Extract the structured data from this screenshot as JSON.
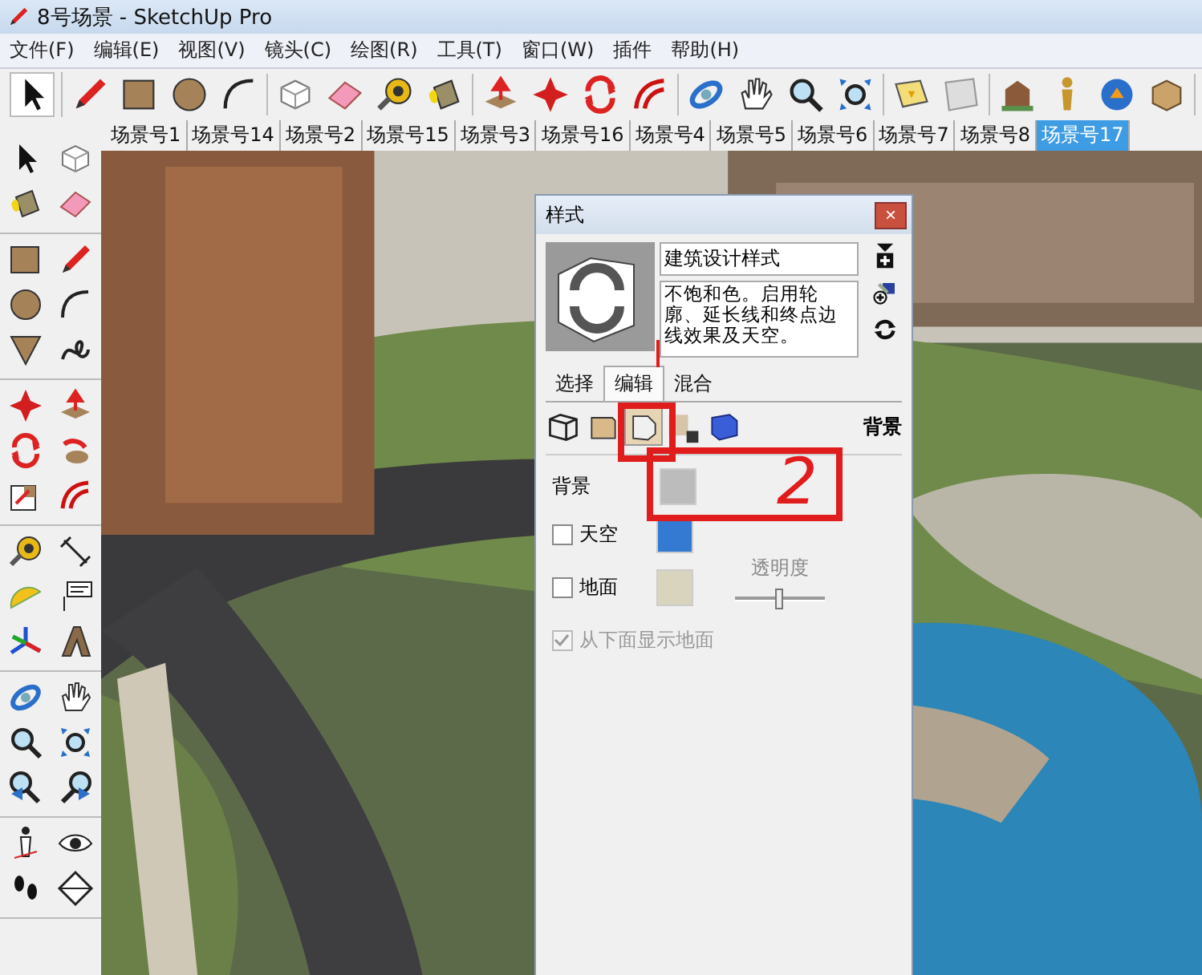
{
  "window": {
    "title": "8号场景 - SketchUp Pro"
  },
  "menu": [
    "文件(F)",
    "编辑(E)",
    "视图(V)",
    "镜头(C)",
    "绘图(R)",
    "工具(T)",
    "窗口(W)",
    "插件",
    "帮助(H)"
  ],
  "scene_tabs": [
    {
      "label": "场景号1",
      "selected": false
    },
    {
      "label": "场景号14",
      "selected": false
    },
    {
      "label": "场景号2",
      "selected": false
    },
    {
      "label": "场景号15",
      "selected": false
    },
    {
      "label": "场景号3",
      "selected": false
    },
    {
      "label": "场景号16",
      "selected": false
    },
    {
      "label": "场景号4",
      "selected": false
    },
    {
      "label": "场景号5",
      "selected": false
    },
    {
      "label": "场景号6",
      "selected": false
    },
    {
      "label": "场景号7",
      "selected": false
    },
    {
      "label": "场景号8",
      "selected": false
    },
    {
      "label": "场景号17",
      "selected": true
    }
  ],
  "styles_panel": {
    "title": "样式",
    "close": "×",
    "style_name": "建筑设计样式",
    "description": "不饱和色。启用轮廓、延长线和终点边线效果及天空。",
    "tabs": [
      {
        "label": "选择",
        "selected": false
      },
      {
        "label": "编辑",
        "selected": true
      },
      {
        "label": "混合",
        "selected": false
      }
    ],
    "edit_tools": [
      {
        "kind": "edge",
        "selected": false
      },
      {
        "kind": "face",
        "selected": false
      },
      {
        "kind": "background",
        "selected": true
      },
      {
        "kind": "watermark",
        "selected": false
      },
      {
        "kind": "modeling",
        "selected": false
      }
    ],
    "section_title": "背景",
    "settings": [
      {
        "kind": "swatch",
        "label": "背景",
        "color": "#bcbcbc"
      },
      {
        "kind": "checkbox",
        "label": "天空",
        "checked": false,
        "color": "#3479d2"
      },
      {
        "kind": "checkbox",
        "label": "地面",
        "checked": false,
        "color": "#d9d4bd"
      }
    ],
    "opacity": {
      "label": "透明度",
      "level": 0.5
    },
    "show_ground_below": {
      "label": "从下面显示地面",
      "checked": true,
      "disabled": true
    }
  },
  "annotation": {
    "label": "2"
  }
}
